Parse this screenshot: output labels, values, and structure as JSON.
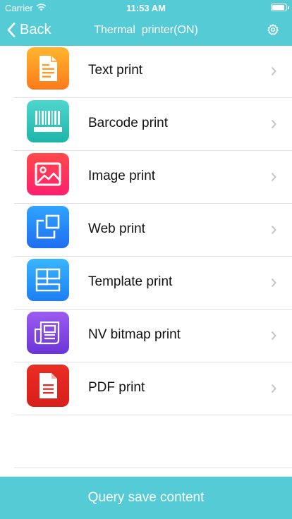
{
  "status_bar": {
    "carrier": "Carrier",
    "time": "11:53 AM",
    "battery_level": 0.95
  },
  "nav": {
    "back_label": "Back",
    "title": "Thermal  printer(ON)",
    "back_icon": "chevron-left-icon",
    "settings_icon": "gear-icon"
  },
  "items": [
    {
      "label": "Text print",
      "icon": "document-text-icon",
      "colors": [
        "#ffb52e",
        "#ff7a1a"
      ]
    },
    {
      "label": "Barcode print",
      "icon": "barcode-icon",
      "colors": [
        "#4fd6cf",
        "#1eb5a9"
      ]
    },
    {
      "label": "Image print",
      "icon": "image-icon",
      "colors": [
        "#ff4a4a",
        "#ff1f6e"
      ]
    },
    {
      "label": "Web print",
      "icon": "web-window-icon",
      "colors": [
        "#2fa4ff",
        "#1f6ef0"
      ]
    },
    {
      "label": "Template print",
      "icon": "template-layout-icon",
      "colors": [
        "#38b6ff",
        "#1d7ef3"
      ]
    },
    {
      "label": "NV bitmap print",
      "icon": "bitmap-newspaper-icon",
      "colors": [
        "#9d5bf2",
        "#6b35d6"
      ]
    },
    {
      "label": "PDF print",
      "icon": "pdf-file-icon",
      "colors": [
        "#ea2d24",
        "#d81f1a"
      ]
    }
  ],
  "footer": {
    "button_label": "Query save content"
  },
  "colors": {
    "accent": "#54cbd5",
    "chevron": "#c4c4c7",
    "separator": "#e2e2e2"
  }
}
